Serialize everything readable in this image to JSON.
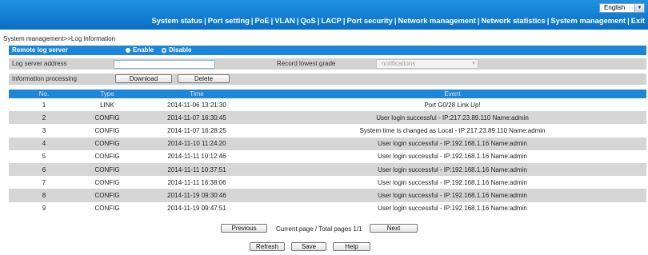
{
  "header": {
    "language": "English",
    "nav": [
      "System status",
      "Port setting",
      "PoE",
      "VLAN",
      "QoS",
      "LACP",
      "Port security",
      "Network management",
      "Network statistics",
      "System management",
      "Exit"
    ]
  },
  "breadcrumb": "System management>>Log information",
  "remote": {
    "label": "Remote log server",
    "enable_label": "Enable",
    "disable_label": "Disable",
    "selected": "Disable"
  },
  "log_server": {
    "label": "Log server address",
    "value": "",
    "grade_label": "Record lowest grade",
    "grade_value": "notifications"
  },
  "processing": {
    "label": "Information processing",
    "download_label": "Download",
    "delete_label": "Delete"
  },
  "table": {
    "headers": [
      "No.",
      "Type",
      "Time",
      "Event"
    ],
    "rows": [
      [
        "1",
        "LINK",
        "2014-11-06 13:21:30",
        "Port G0/28 Link Up!"
      ],
      [
        "2",
        "CONFIG",
        "2014-11-07 16:30:45",
        "User login successful - IP:217.23.89.110 Name:admin"
      ],
      [
        "3",
        "CONFIG",
        "2014-11-07 16:28:25",
        "System time is changed as Local - IP:217.23.89.110 Name:admin"
      ],
      [
        "4",
        "CONFIG",
        "2014-11-10 11:24:20",
        "User login successful - IP:192.168.1.16 Name:admin"
      ],
      [
        "5",
        "CONFIG",
        "2014-11-11 10:12:46",
        "User login successful - IP:192.168.1.16 Name:admin"
      ],
      [
        "6",
        "CONFIG",
        "2014-11-11 10:37:51",
        "User login successful - IP:192.168.1.16 Name:admin"
      ],
      [
        "7",
        "CONFIG",
        "2014-11-11 16:38:06",
        "User login successful - IP:192.168.1.16 Name:admin"
      ],
      [
        "8",
        "CONFIG",
        "2014-11-19 09:30:46",
        "User login successful - IP:192.168.1.16 Name:admin"
      ],
      [
        "9",
        "CONFIG",
        "2014-11-19 09:47:51",
        "User login successful - IP:192.168.1.16 Name:admin"
      ]
    ]
  },
  "pager": {
    "previous_label": "Previous",
    "info": "Current page / Total pages 1/1",
    "next_label": "Next"
  },
  "footer": {
    "refresh_label": "Refresh",
    "save_label": "Save",
    "help_label": "Help"
  },
  "colors": {
    "header_blue": "#0a6fc6",
    "bar_blue": "#1d86d8",
    "row_gray": "#d6d6d6"
  }
}
